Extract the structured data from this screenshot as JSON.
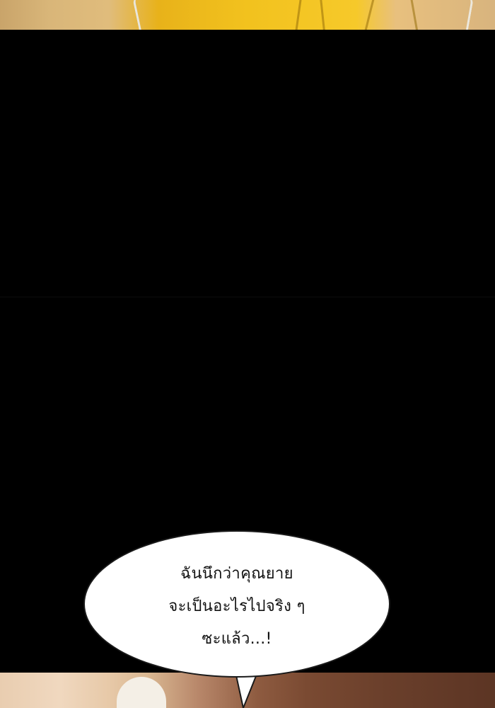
{
  "panels": {
    "top": {
      "description_icon": "yellow-hair-panel"
    },
    "bottom": {
      "description_icon": "room-interior-panel"
    }
  },
  "speech_bubble": {
    "lines": [
      "ฉันนึกว่าคุณยาย",
      "จะเป็นอะไรไปจริง ๆ",
      "ซะแล้ว...!"
    ]
  }
}
